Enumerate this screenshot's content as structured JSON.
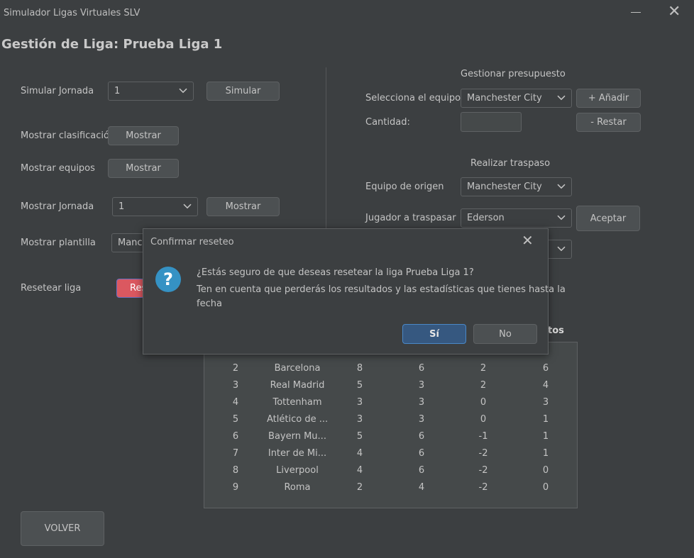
{
  "window": {
    "title": "Simulador Ligas Virtuales SLV",
    "heading": "Gestión de Liga: Prueba Liga 1"
  },
  "left": {
    "simular_label": "Simular Jornada",
    "simular_value": "1",
    "simular_button": "Simular",
    "clasificacion_label": "Mostrar clasificación",
    "clasificacion_button": "Mostrar",
    "equipos_label": "Mostrar equipos",
    "equipos_button": "Mostrar",
    "jornada_label": "Mostrar Jornada",
    "jornada_value": "1",
    "jornada_button": "Mostrar",
    "plantilla_label": "Mostrar plantilla",
    "plantilla_value": "Manc",
    "reset_label": "Resetear liga",
    "reset_button": "Res",
    "volver_button": "VOLVER"
  },
  "right": {
    "presupuesto_title": "Gestionar presupuesto",
    "equipo_label": "Selecciona el equipo",
    "equipo_value": "Manchester City",
    "add_button": "+ Añadir",
    "cantidad_label": "Cantidad:",
    "cantidad_value": "",
    "restar_button": "- Restar",
    "traspaso_title": "Realizar traspaso",
    "origen_label": "Equipo de origen",
    "origen_value": "Manchester City",
    "jugador_label": "Jugador a traspasar",
    "jugador_value": "Ederson",
    "aceptar_button": "Aceptar"
  },
  "table": {
    "visible_header": "tos",
    "rows": [
      [
        "2",
        "Barcelona",
        "8",
        "6",
        "2",
        "6"
      ],
      [
        "3",
        "Real Madrid",
        "5",
        "3",
        "2",
        "4"
      ],
      [
        "4",
        "Tottenham",
        "3",
        "3",
        "0",
        "3"
      ],
      [
        "5",
        "Atlético de ...",
        "3",
        "3",
        "0",
        "1"
      ],
      [
        "6",
        "Bayern Mu...",
        "5",
        "6",
        "-1",
        "1"
      ],
      [
        "7",
        "Inter de Mi...",
        "4",
        "6",
        "-2",
        "1"
      ],
      [
        "8",
        "Liverpool",
        "4",
        "6",
        "-2",
        "0"
      ],
      [
        "9",
        "Roma",
        "2",
        "4",
        "-2",
        "0"
      ]
    ]
  },
  "dialog": {
    "title": "Confirmar reseteo",
    "line1": "¿Estás seguro de que deseas resetear la liga Prueba Liga 1?",
    "line2": "Ten en cuenta que perderás los resultados y las estadísticas que tienes hasta la",
    "line3": "fecha",
    "yes_button": "Sí",
    "no_button": "No"
  }
}
